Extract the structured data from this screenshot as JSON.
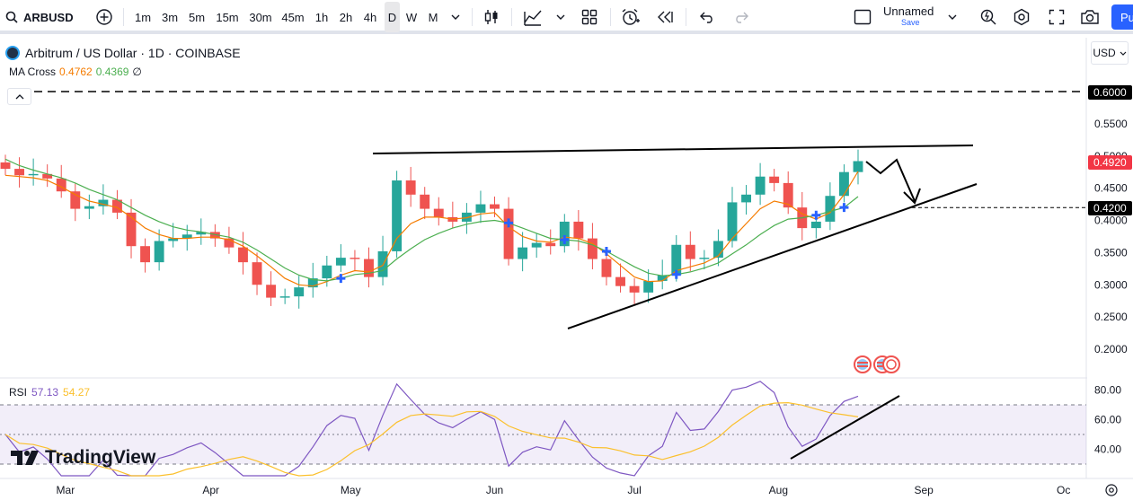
{
  "toolbar": {
    "symbol": "ARBUSD",
    "intervals": [
      "1m",
      "3m",
      "5m",
      "15m",
      "30m",
      "45m",
      "1h",
      "2h",
      "4h",
      "D",
      "W",
      "M"
    ],
    "active_interval": "D",
    "layout_name": "Unnamed",
    "save_label": "Save",
    "publish_label": "Pu"
  },
  "legend": {
    "title": "Arbitrum / US Dollar · 1D · COINBASE",
    "indicator_name": "MA Cross",
    "ma_fast": "0.4762",
    "ma_slow": "0.4369",
    "suffix": "∅"
  },
  "rsi": {
    "name": "RSI",
    "value": "57.13",
    "ma_value": "54.27",
    "levels": [
      "80.00",
      "60.00",
      "40.00"
    ]
  },
  "currency": "USD",
  "brand": "TradingView",
  "colors": {
    "up": "#26a69a",
    "down": "#ef5350",
    "ma_fast": "#f57c00",
    "ma_slow": "#4caf50",
    "rsi_line": "#7e57c2",
    "rsi_ma": "#fbc02d",
    "cross": "#2962ff",
    "last_price_bg": "#f23645"
  },
  "price_scale": {
    "ticks": [
      "0.5500",
      "0.5000",
      "0.4500",
      "0.4000",
      "0.3500",
      "0.3000",
      "0.2500",
      "0.2000"
    ],
    "labels": {
      "target": "0.6000",
      "last": "0.4920",
      "support": "0.4200"
    }
  },
  "time_axis": [
    "Mar",
    "Apr",
    "May",
    "Jun",
    "Jul",
    "Aug",
    "Sep",
    "Oc"
  ],
  "chart_data": {
    "type": "candlestick",
    "series_meta": "ARBUSD daily, Mar – mid Aug",
    "ylim": [
      0.18,
      0.62
    ],
    "x": [
      "Feb 17",
      "Feb 20",
      "Feb 23",
      "Feb 26",
      "Feb 29",
      "Mar 3",
      "Mar 6",
      "Mar 9",
      "Mar 12",
      "Mar 15",
      "Mar 18",
      "Mar 21",
      "Mar 24",
      "Mar 27",
      "Mar 30",
      "Apr 2",
      "Apr 5",
      "Apr 8",
      "Apr 11",
      "Apr 14",
      "Apr 17",
      "Apr 20",
      "Apr 23",
      "Apr 26",
      "Apr 29",
      "May 2",
      "May 5",
      "May 8",
      "May 11",
      "May 14",
      "May 17",
      "May 20",
      "May 23",
      "May 26",
      "May 29",
      "Jun 1",
      "Jun 4",
      "Jun 7",
      "Jun 10",
      "Jun 13",
      "Jun 16",
      "Jun 19",
      "Jun 22",
      "Jun 25",
      "Jun 28",
      "Jul 1",
      "Jul 4",
      "Jul 7",
      "Jul 10",
      "Jul 13",
      "Jul 16",
      "Jul 19",
      "Jul 22",
      "Jul 25",
      "Jul 28",
      "Jul 31",
      "Aug 3",
      "Aug 6",
      "Aug 9",
      "Aug 12",
      "Aug 15",
      "Aug 18"
    ],
    "close": [
      0.48,
      0.47,
      0.472,
      0.465,
      0.445,
      0.418,
      0.422,
      0.432,
      0.412,
      0.36,
      0.335,
      0.368,
      0.372,
      0.378,
      0.382,
      0.372,
      0.358,
      0.335,
      0.3,
      0.28,
      0.282,
      0.296,
      0.31,
      0.33,
      0.342,
      0.34,
      0.312,
      0.352,
      0.462,
      0.44,
      0.418,
      0.405,
      0.398,
      0.412,
      0.425,
      0.418,
      0.34,
      0.358,
      0.365,
      0.36,
      0.398,
      0.372,
      0.34,
      0.312,
      0.298,
      0.288,
      0.306,
      0.315,
      0.362,
      0.34,
      0.342,
      0.368,
      0.428,
      0.44,
      0.468,
      0.458,
      0.42,
      0.388,
      0.398,
      0.438,
      0.475,
      0.492
    ],
    "ma_fast": [
      0.47,
      0.468,
      0.466,
      0.462,
      0.452,
      0.44,
      0.43,
      0.425,
      0.42,
      0.405,
      0.388,
      0.378,
      0.372,
      0.372,
      0.374,
      0.374,
      0.37,
      0.36,
      0.345,
      0.328,
      0.31,
      0.3,
      0.298,
      0.305,
      0.315,
      0.322,
      0.32,
      0.33,
      0.372,
      0.395,
      0.405,
      0.405,
      0.402,
      0.404,
      0.41,
      0.412,
      0.39,
      0.375,
      0.368,
      0.366,
      0.374,
      0.372,
      0.364,
      0.348,
      0.33,
      0.312,
      0.305,
      0.306,
      0.322,
      0.328,
      0.334,
      0.345,
      0.372,
      0.395,
      0.418,
      0.43,
      0.425,
      0.41,
      0.402,
      0.412,
      0.44,
      0.476
    ],
    "ma_slow": [
      0.495,
      0.485,
      0.478,
      0.472,
      0.466,
      0.458,
      0.448,
      0.44,
      0.432,
      0.42,
      0.408,
      0.398,
      0.39,
      0.385,
      0.382,
      0.378,
      0.374,
      0.366,
      0.354,
      0.34,
      0.326,
      0.315,
      0.308,
      0.306,
      0.31,
      0.316,
      0.318,
      0.322,
      0.34,
      0.356,
      0.37,
      0.38,
      0.388,
      0.394,
      0.398,
      0.4,
      0.396,
      0.388,
      0.38,
      0.372,
      0.37,
      0.368,
      0.362,
      0.352,
      0.34,
      0.328,
      0.318,
      0.314,
      0.316,
      0.32,
      0.326,
      0.334,
      0.348,
      0.362,
      0.378,
      0.392,
      0.402,
      0.404,
      0.408,
      0.414,
      0.42,
      0.437
    ],
    "annotations": {
      "resistance_level": 0.6,
      "support_level": 0.42,
      "last_price": 0.492
    }
  }
}
